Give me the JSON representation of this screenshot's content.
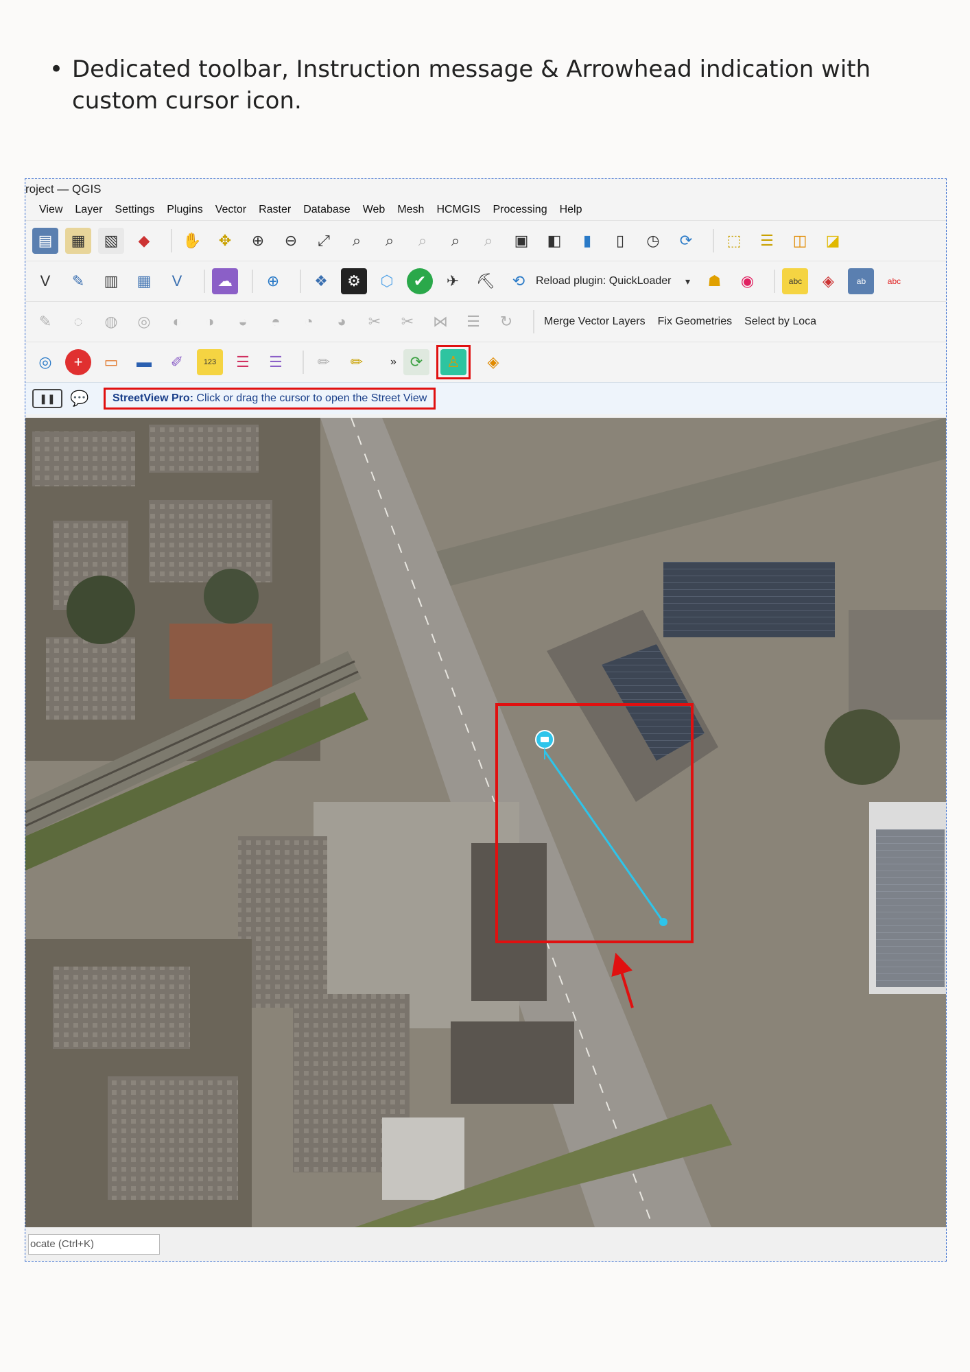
{
  "caption": {
    "bullet": "•",
    "text": "Dedicated toolbar, Instruction message & Arrowhead indication with custom cursor icon."
  },
  "window": {
    "title": "roject — QGIS"
  },
  "menu": [
    "View",
    "Layer",
    "Settings",
    "Plugins",
    "Vector",
    "Raster",
    "Database",
    "Web",
    "Mesh",
    "HCMGIS",
    "Processing",
    "Help"
  ],
  "toolbar2": {
    "reload_label": "Reload plugin: QuickLoader"
  },
  "toolbar3": {
    "merge_label": "Merge Vector Layers",
    "fix_label": "Fix Geometries",
    "select_label": "Select by Loca"
  },
  "toolbar4": {
    "more_label": "»"
  },
  "message": {
    "plugin": "StreetView Pro:",
    "text": "Click or drag the cursor to open the Street View"
  },
  "status": {
    "locator_placeholder": "ocate (Ctrl+K)"
  },
  "colors": {
    "highlight": "#e01010",
    "streetview_line": "#2ec4ea",
    "message_text": "#1a3f8a"
  },
  "icons": [
    "save-icon",
    "pan-icon",
    "zoom-in-icon",
    "zoom-out-icon",
    "python-icon",
    "streetview-icon",
    "layers-icon"
  ]
}
